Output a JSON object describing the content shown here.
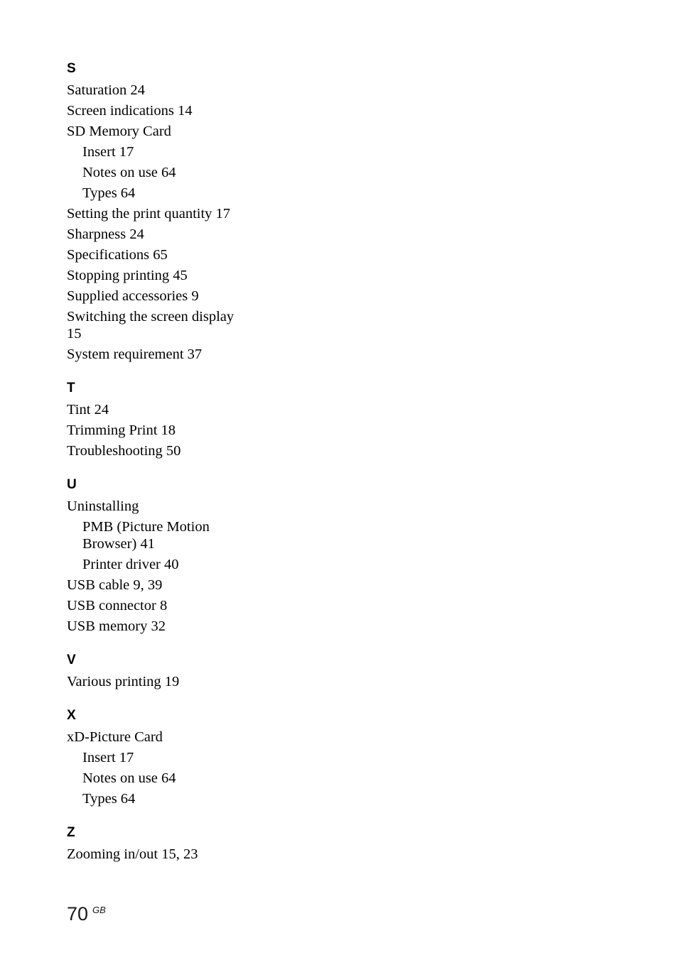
{
  "page": {
    "number": "70",
    "region_code": "GB"
  },
  "index": {
    "sections": [
      {
        "letter": "S",
        "entries": [
          {
            "text": "Saturation 24",
            "level": 0
          },
          {
            "text": "Screen indications 14",
            "level": 0
          },
          {
            "text": "SD Memory Card",
            "level": 0
          },
          {
            "text": "Insert 17",
            "level": 1
          },
          {
            "text": "Notes on use 64",
            "level": 1
          },
          {
            "text": "Types 64",
            "level": 1
          },
          {
            "text": "Setting the print quantity 17",
            "level": 0
          },
          {
            "text": "Sharpness 24",
            "level": 0
          },
          {
            "text": "Specifications 65",
            "level": 0
          },
          {
            "text": "Stopping printing 45",
            "level": 0
          },
          {
            "text": "Supplied accessories 9",
            "level": 0
          },
          {
            "text": "Switching the screen display\n15",
            "level": 0
          },
          {
            "text": "System requirement 37",
            "level": 0
          }
        ]
      },
      {
        "letter": "T",
        "entries": [
          {
            "text": "Tint 24",
            "level": 0
          },
          {
            "text": "Trimming Print 18",
            "level": 0
          },
          {
            "text": "Troubleshooting 50",
            "level": 0
          }
        ]
      },
      {
        "letter": "U",
        "entries": [
          {
            "text": "Uninstalling",
            "level": 0
          },
          {
            "text": "PMB (Picture Motion\nBrowser) 41",
            "level": 1
          },
          {
            "text": "Printer driver 40",
            "level": 1
          },
          {
            "text": "USB cable 9, 39",
            "level": 0
          },
          {
            "text": "USB connector 8",
            "level": 0
          },
          {
            "text": "USB memory 32",
            "level": 0
          }
        ]
      },
      {
        "letter": "V",
        "entries": [
          {
            "text": "Various printing 19",
            "level": 0
          }
        ]
      },
      {
        "letter": "X",
        "entries": [
          {
            "text": "xD-Picture Card",
            "level": 0
          },
          {
            "text": "Insert 17",
            "level": 1
          },
          {
            "text": "Notes on use 64",
            "level": 1
          },
          {
            "text": "Types 64",
            "level": 1
          }
        ]
      },
      {
        "letter": "Z",
        "entries": [
          {
            "text": "Zooming in/out 15, 23",
            "level": 0
          }
        ]
      }
    ]
  }
}
